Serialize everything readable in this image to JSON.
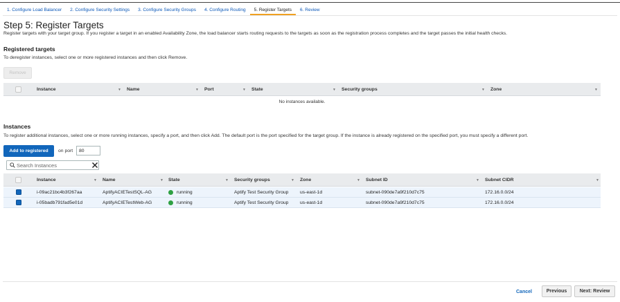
{
  "wizard_tabs": [
    {
      "label": "1. Configure Load Balancer"
    },
    {
      "label": "2. Configure Security Settings"
    },
    {
      "label": "3. Configure Security Groups"
    },
    {
      "label": "4. Configure Routing"
    },
    {
      "label": "5. Register Targets"
    },
    {
      "label": "6. Review"
    }
  ],
  "active_tab": "5. Register Targets",
  "page": {
    "title": "Step 5: Register Targets",
    "description": "Register targets with your target group. If you register a target in an enabled Availability Zone, the load balancer starts routing requests to the targets as soon as the registration process completes and the target passes the initial health checks."
  },
  "registered": {
    "heading": "Registered targets",
    "instructions": "To deregister instances, select one or more registered instances and then click Remove.",
    "remove_label": "Remove",
    "columns": [
      "Instance",
      "Name",
      "Port",
      "State",
      "Security groups",
      "Zone"
    ],
    "empty_message": "No instances available."
  },
  "instances": {
    "heading": "Instances",
    "instructions": "To register additional instances, select one or more running instances, specify a port, and then click Add. The default port is the port specified for the target group. If the instance is already registered on the specified port, you must specify a different port.",
    "add_label": "Add to registered",
    "on_port_label": "on port",
    "port_value": "80",
    "search_placeholder": "Search Instances",
    "columns": [
      "Instance",
      "Name",
      "State",
      "Security groups",
      "Zone",
      "Subnet ID",
      "Subnet CIDR"
    ],
    "rows": [
      {
        "instance": "i-09ac21bc4b3f267aa",
        "name": "AptifyACIETestSQL-AG",
        "state": "running",
        "security_group": "Aptify Test Security Group",
        "zone": "us-east-1d",
        "subnet_id": "subnet-090de7a9f210d7c75",
        "subnet_cidr": "172.16.0.0/24",
        "checked": true
      },
      {
        "instance": "i-05badb791fad5e01d",
        "name": "AptifyACIETestWeb-AG",
        "state": "running",
        "security_group": "Aptify Test Security Group",
        "zone": "us-east-1d",
        "subnet_id": "subnet-090de7a9f210d7c75",
        "subnet_cidr": "172.16.0.0/24",
        "checked": true
      }
    ]
  },
  "footer": {
    "cancel_label": "Cancel",
    "previous_label": "Previous",
    "next_label": "Next: Review"
  },
  "colors": {
    "accent": "#1166bb",
    "active_tab_underline": "#f0a020",
    "running": "#2ea043",
    "selected_row": "#edf4fc"
  },
  "icons": [
    "search-icon",
    "clear-icon",
    "sort-icon",
    "status-dot-icon"
  ]
}
